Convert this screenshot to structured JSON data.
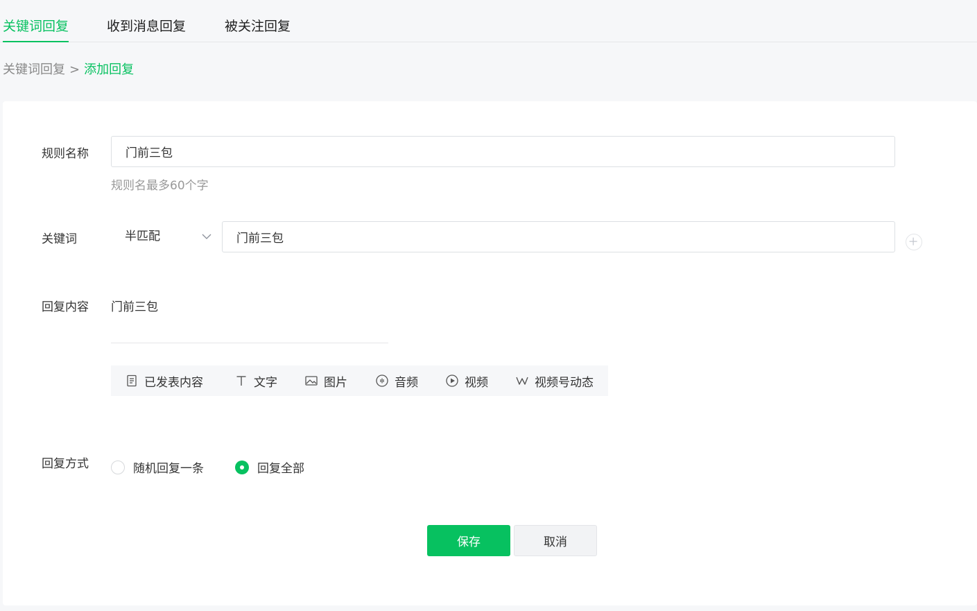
{
  "tabs": [
    {
      "label": "关键词回复",
      "active": true
    },
    {
      "label": "收到消息回复",
      "active": false
    },
    {
      "label": "被关注回复",
      "active": false
    }
  ],
  "breadcrumb": {
    "parent": "关键词回复",
    "separator": ">",
    "current": "添加回复"
  },
  "form": {
    "rule_name": {
      "label": "规则名称",
      "value": "门前三包",
      "hint": "规则名最多60个字"
    },
    "keyword": {
      "label": "关键词",
      "match_type": "半匹配",
      "value": "门前三包",
      "add_icon": "plus-circle-icon"
    },
    "reply_content": {
      "label": "回复内容",
      "text": "门前三包",
      "toolbar": [
        {
          "label": "已发表内容",
          "icon": "document-icon"
        },
        {
          "label": "文字",
          "icon": "text-icon"
        },
        {
          "label": "图片",
          "icon": "image-icon"
        },
        {
          "label": "音频",
          "icon": "audio-icon"
        },
        {
          "label": "视频",
          "icon": "video-play-icon"
        },
        {
          "label": "视频号动态",
          "icon": "channels-icon"
        }
      ]
    },
    "reply_mode": {
      "label": "回复方式",
      "options": [
        {
          "label": "随机回复一条",
          "checked": false
        },
        {
          "label": "回复全部",
          "checked": true
        }
      ]
    }
  },
  "actions": {
    "save_label": "保存",
    "cancel_label": "取消"
  },
  "colors": {
    "accent": "#07c160",
    "page_background": "#f6f7f9",
    "card_background": "#ffffff"
  }
}
